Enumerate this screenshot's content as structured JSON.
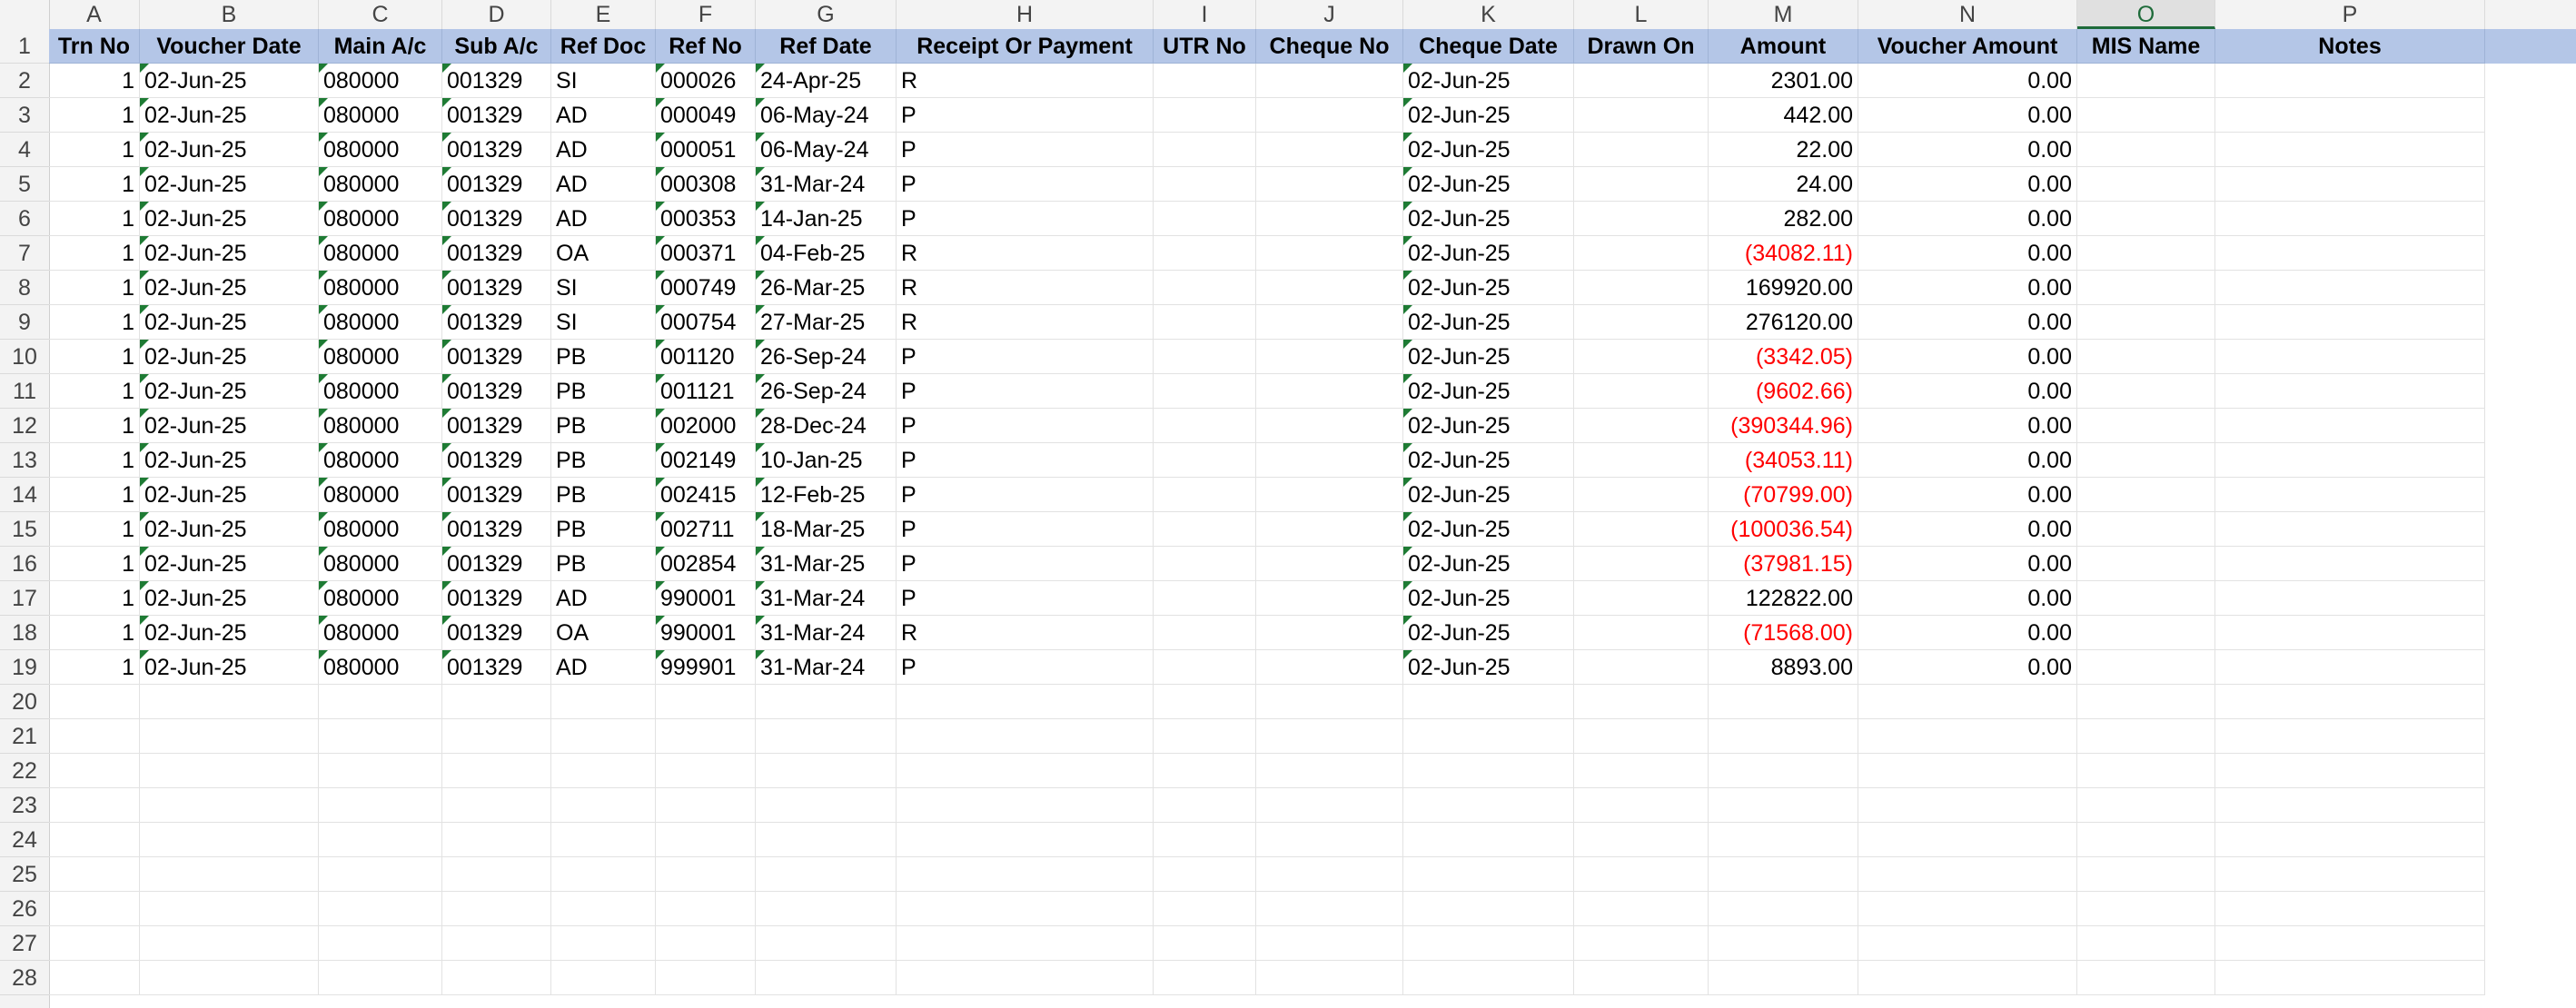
{
  "columns": [
    "A",
    "B",
    "C",
    "D",
    "E",
    "F",
    "G",
    "H",
    "I",
    "J",
    "K",
    "L",
    "M",
    "N",
    "O",
    "P"
  ],
  "selected_column": "O",
  "headers": [
    "Trn No",
    "Voucher Date",
    "Main A/c",
    "Sub A/c",
    "Ref Doc",
    "Ref No",
    "Ref Date",
    "Receipt Or Payment",
    "UTR No",
    "Cheque No",
    "Cheque Date",
    "Drawn On",
    "Amount",
    "Voucher Amount",
    "MIS Name",
    "Notes"
  ],
  "rows": [
    {
      "trn": "1",
      "vdate": "02-Jun-25",
      "main": "080000",
      "sub": "001329",
      "refdoc": "SI",
      "refno": "000026",
      "refdate": "24-Apr-25",
      "rp": "R",
      "cdate": "02-Jun-25",
      "amount": "2301.00",
      "neg": false,
      "vamount": "0.00"
    },
    {
      "trn": "1",
      "vdate": "02-Jun-25",
      "main": "080000",
      "sub": "001329",
      "refdoc": "AD",
      "refno": "000049",
      "refdate": "06-May-24",
      "rp": "P",
      "cdate": "02-Jun-25",
      "amount": "442.00",
      "neg": false,
      "vamount": "0.00"
    },
    {
      "trn": "1",
      "vdate": "02-Jun-25",
      "main": "080000",
      "sub": "001329",
      "refdoc": "AD",
      "refno": "000051",
      "refdate": "06-May-24",
      "rp": "P",
      "cdate": "02-Jun-25",
      "amount": "22.00",
      "neg": false,
      "vamount": "0.00"
    },
    {
      "trn": "1",
      "vdate": "02-Jun-25",
      "main": "080000",
      "sub": "001329",
      "refdoc": "AD",
      "refno": "000308",
      "refdate": "31-Mar-24",
      "rp": "P",
      "cdate": "02-Jun-25",
      "amount": "24.00",
      "neg": false,
      "vamount": "0.00"
    },
    {
      "trn": "1",
      "vdate": "02-Jun-25",
      "main": "080000",
      "sub": "001329",
      "refdoc": "AD",
      "refno": "000353",
      "refdate": "14-Jan-25",
      "rp": "P",
      "cdate": "02-Jun-25",
      "amount": "282.00",
      "neg": false,
      "vamount": "0.00"
    },
    {
      "trn": "1",
      "vdate": "02-Jun-25",
      "main": "080000",
      "sub": "001329",
      "refdoc": "OA",
      "refno": "000371",
      "refdate": "04-Feb-25",
      "rp": "R",
      "cdate": "02-Jun-25",
      "amount": "(34082.11)",
      "neg": true,
      "vamount": "0.00"
    },
    {
      "trn": "1",
      "vdate": "02-Jun-25",
      "main": "080000",
      "sub": "001329",
      "refdoc": "SI",
      "refno": "000749",
      "refdate": "26-Mar-25",
      "rp": "R",
      "cdate": "02-Jun-25",
      "amount": "169920.00",
      "neg": false,
      "vamount": "0.00"
    },
    {
      "trn": "1",
      "vdate": "02-Jun-25",
      "main": "080000",
      "sub": "001329",
      "refdoc": "SI",
      "refno": "000754",
      "refdate": "27-Mar-25",
      "rp": "R",
      "cdate": "02-Jun-25",
      "amount": "276120.00",
      "neg": false,
      "vamount": "0.00"
    },
    {
      "trn": "1",
      "vdate": "02-Jun-25",
      "main": "080000",
      "sub": "001329",
      "refdoc": "PB",
      "refno": "001120",
      "refdate": "26-Sep-24",
      "rp": "P",
      "cdate": "02-Jun-25",
      "amount": "(3342.05)",
      "neg": true,
      "vamount": "0.00"
    },
    {
      "trn": "1",
      "vdate": "02-Jun-25",
      "main": "080000",
      "sub": "001329",
      "refdoc": "PB",
      "refno": "001121",
      "refdate": "26-Sep-24",
      "rp": "P",
      "cdate": "02-Jun-25",
      "amount": "(9602.66)",
      "neg": true,
      "vamount": "0.00"
    },
    {
      "trn": "1",
      "vdate": "02-Jun-25",
      "main": "080000",
      "sub": "001329",
      "refdoc": "PB",
      "refno": "002000",
      "refdate": "28-Dec-24",
      "rp": "P",
      "cdate": "02-Jun-25",
      "amount": "(390344.96)",
      "neg": true,
      "vamount": "0.00"
    },
    {
      "trn": "1",
      "vdate": "02-Jun-25",
      "main": "080000",
      "sub": "001329",
      "refdoc": "PB",
      "refno": "002149",
      "refdate": "10-Jan-25",
      "rp": "P",
      "cdate": "02-Jun-25",
      "amount": "(34053.11)",
      "neg": true,
      "vamount": "0.00"
    },
    {
      "trn": "1",
      "vdate": "02-Jun-25",
      "main": "080000",
      "sub": "001329",
      "refdoc": "PB",
      "refno": "002415",
      "refdate": "12-Feb-25",
      "rp": "P",
      "cdate": "02-Jun-25",
      "amount": "(70799.00)",
      "neg": true,
      "vamount": "0.00"
    },
    {
      "trn": "1",
      "vdate": "02-Jun-25",
      "main": "080000",
      "sub": "001329",
      "refdoc": "PB",
      "refno": "002711",
      "refdate": "18-Mar-25",
      "rp": "P",
      "cdate": "02-Jun-25",
      "amount": "(100036.54)",
      "neg": true,
      "vamount": "0.00"
    },
    {
      "trn": "1",
      "vdate": "02-Jun-25",
      "main": "080000",
      "sub": "001329",
      "refdoc": "PB",
      "refno": "002854",
      "refdate": "31-Mar-25",
      "rp": "P",
      "cdate": "02-Jun-25",
      "amount": "(37981.15)",
      "neg": true,
      "vamount": "0.00"
    },
    {
      "trn": "1",
      "vdate": "02-Jun-25",
      "main": "080000",
      "sub": "001329",
      "refdoc": "AD",
      "refno": "990001",
      "refdate": "31-Mar-24",
      "rp": "P",
      "cdate": "02-Jun-25",
      "amount": "122822.00",
      "neg": false,
      "vamount": "0.00"
    },
    {
      "trn": "1",
      "vdate": "02-Jun-25",
      "main": "080000",
      "sub": "001329",
      "refdoc": "OA",
      "refno": "990001",
      "refdate": "31-Mar-24",
      "rp": "R",
      "cdate": "02-Jun-25",
      "amount": "(71568.00)",
      "neg": true,
      "vamount": "0.00"
    },
    {
      "trn": "1",
      "vdate": "02-Jun-25",
      "main": "080000",
      "sub": "001329",
      "refdoc": "AD",
      "refno": "999901",
      "refdate": "31-Mar-24",
      "rp": "P",
      "cdate": "02-Jun-25",
      "amount": "8893.00",
      "neg": false,
      "vamount": "0.00"
    }
  ],
  "total_row_numbers": 28,
  "colors": {
    "header_fill": "#b4c6e7",
    "negative": "#ff0000",
    "text_flag": "#1e7b34",
    "selected_col": "#1e6b3a"
  }
}
